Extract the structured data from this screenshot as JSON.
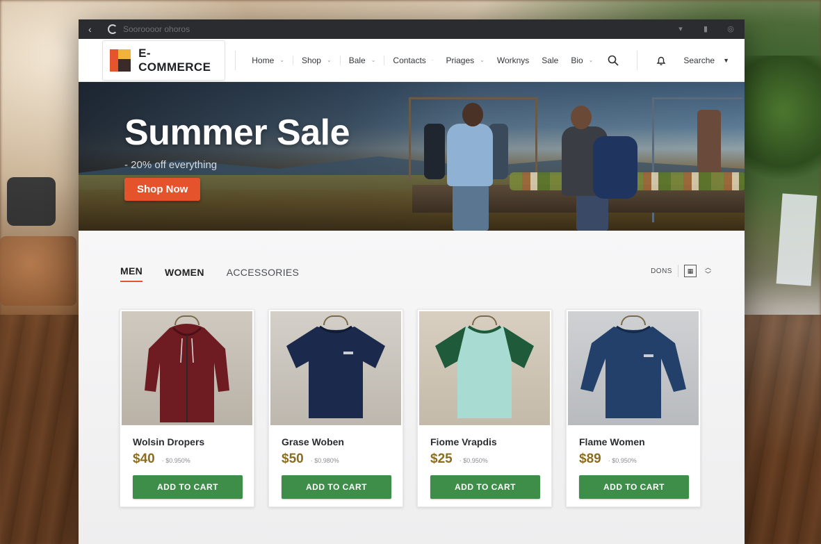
{
  "browser": {
    "url": "Sooroooor ohoros"
  },
  "nav": {
    "logo_text": "E-COMMERCE",
    "menu": [
      {
        "label": "Home",
        "has_dropdown": true
      },
      {
        "label": "Shop",
        "has_dropdown": true
      },
      {
        "label": "Bale",
        "has_dropdown": true
      },
      {
        "label": "Contacts",
        "has_dropdown": true
      },
      {
        "label": "Priages",
        "has_dropdown": true
      },
      {
        "label": "Worknys",
        "has_dropdown": false
      },
      {
        "label": "Sale",
        "has_dropdown": false
      },
      {
        "label": "Bio",
        "has_dropdown": true
      }
    ],
    "search_label": "Searche"
  },
  "hero": {
    "title": "Summer Sale",
    "subtitle": "- 20% off everything",
    "cta": "Shop Now"
  },
  "tabs": [
    {
      "label": "MEN",
      "state": "active"
    },
    {
      "label": "WOMEN",
      "state": "bold"
    },
    {
      "label": "ACCESSORIES",
      "state": "plain"
    }
  ],
  "view_tools": {
    "label": "DONS"
  },
  "products": [
    {
      "name": "Wolsin Dropers",
      "price": "$40",
      "old_price": "· $0.950%",
      "button": "ADD TO CART",
      "image": "maroon-zip-hoodie"
    },
    {
      "name": "Grase Woben",
      "price": "$50",
      "old_price": "· $0.980%",
      "button": "ADD TO CART",
      "image": "navy-tshirt"
    },
    {
      "name": "Fiome Vrapdis",
      "price": "$25",
      "old_price": "· $0.950%",
      "button": "ADD TO CART",
      "image": "mint-green-raglan-tee"
    },
    {
      "name": "Flame Women",
      "price": "$89",
      "old_price": "· $0.950%",
      "button": "ADD TO CART",
      "image": "blue-long-sleeve-tee"
    }
  ],
  "colors": {
    "accent": "#e4532c",
    "cart_button": "#3e8e4a",
    "price": "#8a6d1f"
  }
}
